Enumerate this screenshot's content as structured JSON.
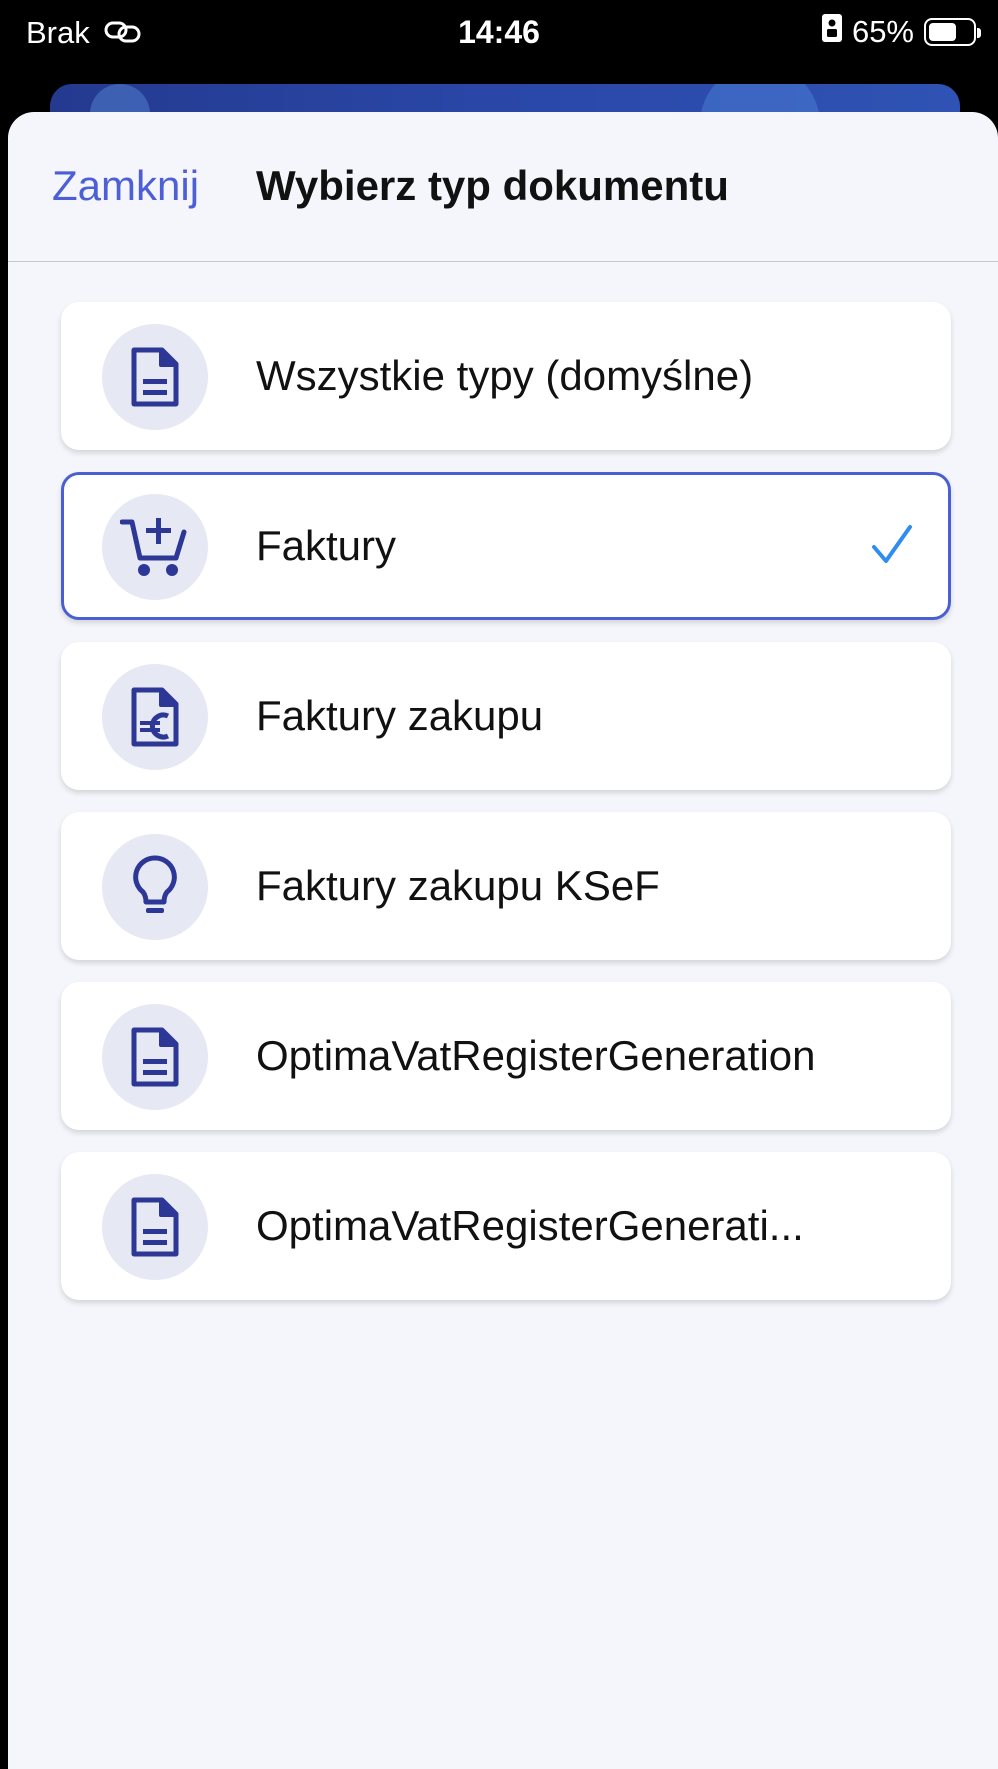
{
  "status_bar": {
    "carrier": "Brak",
    "time": "14:46",
    "battery_percent": "65%",
    "battery_level": 0.65
  },
  "sheet": {
    "close_label": "Zamknij",
    "title": "Wybierz typ dokumentu"
  },
  "options": [
    {
      "label": "Wszystkie typy (domyślne)",
      "icon": "document-icon",
      "selected": false
    },
    {
      "label": "Faktury",
      "icon": "cart-plus-icon",
      "selected": true
    },
    {
      "label": "Faktury zakupu",
      "icon": "euro-document-icon",
      "selected": false
    },
    {
      "label": "Faktury zakupu KSeF",
      "icon": "lightbulb-icon",
      "selected": false
    },
    {
      "label": "OptimaVatRegisterGeneration",
      "icon": "document-icon",
      "selected": false
    },
    {
      "label": "OptimaVatRegisterGenerati...",
      "icon": "document-icon",
      "selected": false
    }
  ],
  "colors": {
    "accent": "#4a5fd4",
    "icon": "#2c3796",
    "check": "#2f8cf0"
  }
}
